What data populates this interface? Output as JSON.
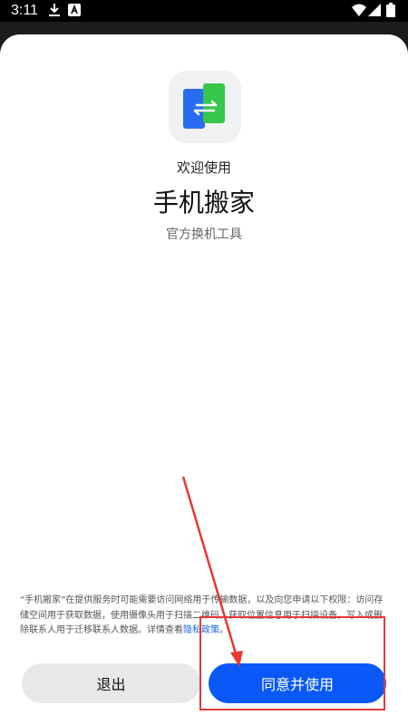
{
  "status_bar": {
    "time": "3:11",
    "left_icons": [
      "download-icon",
      "font-a-icon"
    ],
    "right_icons": [
      "wifi-icon",
      "signal-icon",
      "battery-icon"
    ]
  },
  "app": {
    "welcome": "欢迎使用",
    "name": "手机搬家",
    "subtitle": "官方换机工具",
    "logo_colors": {
      "blue": "#2a6cf0",
      "green": "#36c64a"
    }
  },
  "notice": {
    "text": "“手机搬家”在提供服务时可能需要访问网络用于传输数据，以及向您申请以下权限：访问存储空间用于获取数据，使用摄像头用于扫描二维码，获取位置信息用于扫描设备，写入或删除联系人用于迁移联系人数据。详情查看",
    "link": "隐私政策",
    "end": "。"
  },
  "buttons": {
    "exit": "退出",
    "agree": "同意并使用"
  },
  "colors": {
    "accent": "#0a59f7",
    "annotation": "#e53935"
  }
}
